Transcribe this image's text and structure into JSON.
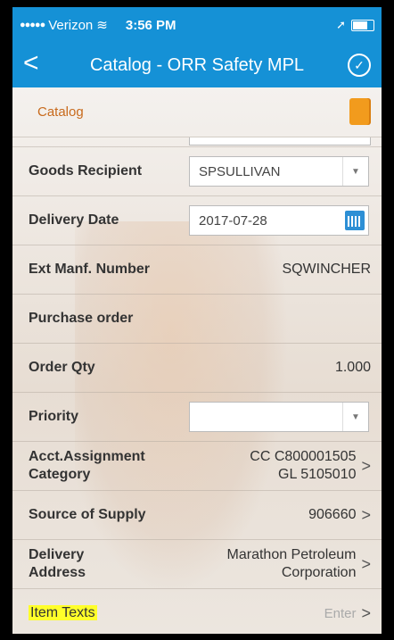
{
  "status": {
    "carrier": "Verizon",
    "signal": "●●●●●",
    "time": "3:56 PM"
  },
  "nav": {
    "title": "Catalog - ORR Safety MPL",
    "back_icon": "chevron-left-icon",
    "done_icon": "checkmark-circle-icon"
  },
  "catalog": {
    "label": "Catalog"
  },
  "fields": {
    "goods_recipient": {
      "label": "Goods Recipient",
      "value": "SPSULLIVAN"
    },
    "delivery_date": {
      "label": "Delivery Date",
      "value": "2017-07-28"
    },
    "ext_manf_number": {
      "label": "Ext Manf. Number",
      "value": "SQWINCHER"
    },
    "purchase_order": {
      "label": "Purchase order",
      "value": ""
    },
    "order_qty": {
      "label": "Order Qty",
      "value": "1.000"
    },
    "priority": {
      "label": "Priority",
      "value": ""
    },
    "acct_assignment": {
      "label1": "Acct.Assignment",
      "label2": "Category",
      "value1": "CC C800001505",
      "value2": "GL 5105010"
    },
    "source_of_supply": {
      "label": "Source of Supply",
      "value": "906660"
    },
    "delivery_address": {
      "label1": "Delivery",
      "label2": "Address",
      "value1": "Marathon Petroleum",
      "value2": "Corporation"
    },
    "item_texts": {
      "label": "Item Texts",
      "value": "Enter"
    }
  },
  "colors": {
    "bar": "#1591d6",
    "catalog_text": "#c86a1c",
    "highlight": "#ffff2a"
  }
}
